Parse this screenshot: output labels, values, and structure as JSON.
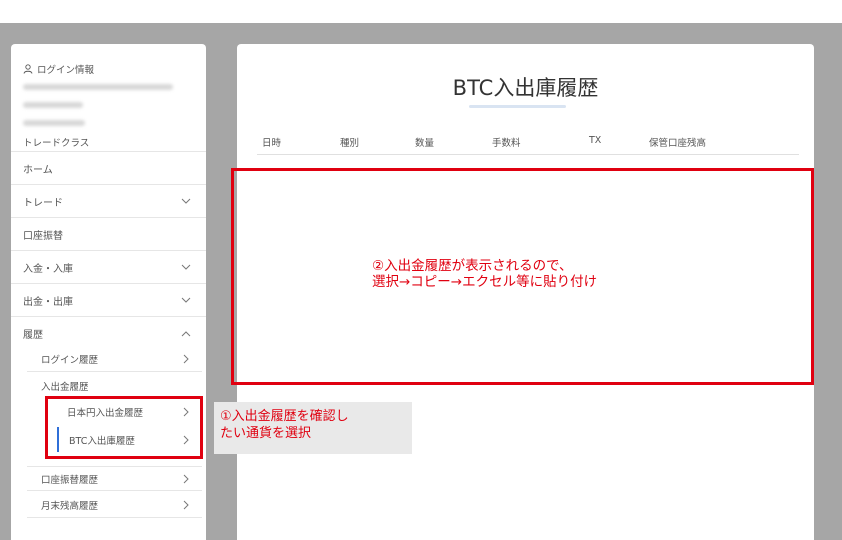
{
  "sidebar": {
    "login_info": "ログイン情報",
    "trade_class": "トレードクラス",
    "items": [
      {
        "label": "ホーム",
        "chevron": ""
      },
      {
        "label": "トレード",
        "chevron": "down"
      },
      {
        "label": "口座振替",
        "chevron": ""
      },
      {
        "label": "入金・入庫",
        "chevron": "down"
      },
      {
        "label": "出金・出庫",
        "chevron": "down"
      },
      {
        "label": "履歴",
        "chevron": "up"
      }
    ],
    "history": {
      "login_history": "ログイン履歴",
      "deposit_history": "入出金履歴",
      "jpy_history": "日本円入出金履歴",
      "btc_history": "BTC入出庫履歴",
      "transfer_history": "口座振替履歴",
      "monthly_balance": "月末残高履歴"
    }
  },
  "main": {
    "title": "BTC入出庫履歴",
    "columns": [
      "日時",
      "種別",
      "数量",
      "手数料",
      "TX",
      "保管口座残高"
    ]
  },
  "annotations": {
    "note2": "②入出金履歴が表示されるので、\n選択→コピー→エクセル等に貼り付け",
    "note1": "①入出金履歴を確認し\nたい通貨を選択"
  },
  "colors": {
    "highlight_red": "#e00010",
    "active_marker": "#2f6fd8",
    "backdrop": "#a6a6a6"
  }
}
